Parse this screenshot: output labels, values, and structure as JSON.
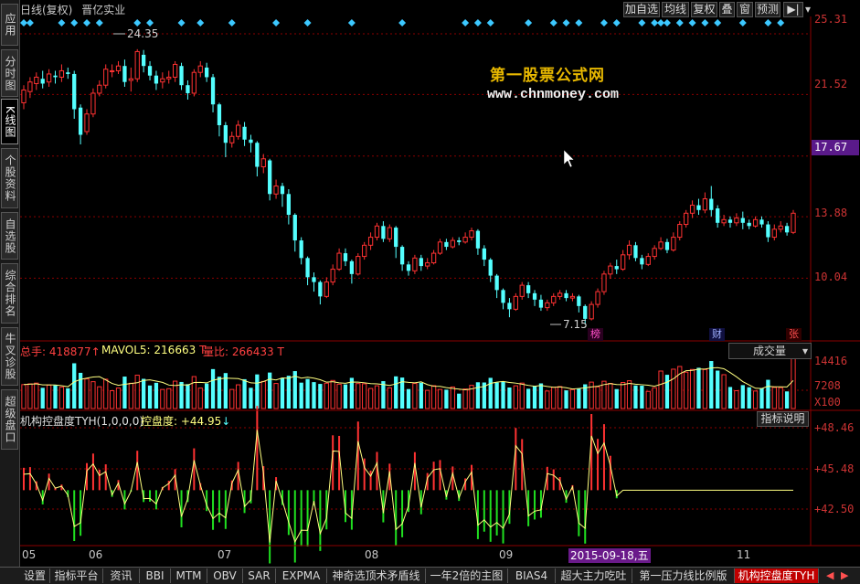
{
  "header": {
    "title": "日线(复权)",
    "stock_name": "晋亿实业",
    "buttons": [
      "加自选",
      "均线",
      "复权",
      "叠",
      "窗",
      "预测"
    ],
    "nav_arrow": "▶|"
  },
  "left_tabs": [
    {
      "label": "应用",
      "active": false
    },
    {
      "label": "分时图",
      "active": false
    },
    {
      "label": "K线图",
      "active": true
    },
    {
      "label": "个股资料",
      "active": false
    },
    {
      "label": "自选股",
      "active": false
    },
    {
      "label": "综合排名",
      "active": false
    },
    {
      "label": "牛叉诊股",
      "active": false
    },
    {
      "label": "超级盘口",
      "active": false
    }
  ],
  "price_axis": {
    "labels": [
      "25.31",
      "21.52",
      "17.67",
      "13.88",
      "10.04"
    ],
    "current_price_box": "17.67"
  },
  "watermark": {
    "cn": "第一股票公式网",
    "url": "www.chnmoney.com"
  },
  "annotations": {
    "high": "24.35",
    "low": "7.15"
  },
  "event_marks": [
    {
      "text": "榜",
      "color": "#ff50c8"
    },
    {
      "text": "财",
      "color": "#a0b0ff"
    },
    {
      "text": "张",
      "color": "#ff5050"
    }
  ],
  "volume_panel": {
    "total_label": "总手: 418877",
    "total_arrow": "↑",
    "mavol5_label": "MAVOL5: 216663",
    "mavol5_unit": "T",
    "ratio_label": "量比: 266433",
    "ratio_unit": "T",
    "dropdown": "成交量",
    "axis_labels": [
      "14416",
      "7208",
      "X100"
    ]
  },
  "indicator_panel": {
    "name": "机构控盘度TYH(1,0,0,0)",
    "value_label": "控盘度: +44.95",
    "value_arrow": "↓",
    "button": "指标说明",
    "axis_labels": [
      "+48.46",
      "+45.48",
      "+42.50"
    ]
  },
  "x_axis": {
    "months": [
      "05",
      "06",
      "07",
      "08",
      "09",
      "11"
    ],
    "selected_date": "2015-09-18,五"
  },
  "bottom_tabs": [
    {
      "label": "设置",
      "active": false
    },
    {
      "label": "指标平台",
      "active": false
    },
    {
      "label": "资讯",
      "active": false
    },
    {
      "label": "BBI",
      "active": false
    },
    {
      "label": "MTM",
      "active": false
    },
    {
      "label": "OBV",
      "active": false
    },
    {
      "label": "SAR",
      "active": false
    },
    {
      "label": "EXPMA",
      "active": false
    },
    {
      "label": "神奇选顶术矛盾线",
      "active": false
    },
    {
      "label": "一年2倍的主图",
      "active": false
    },
    {
      "label": "BIAS4",
      "active": false
    },
    {
      "label": "超大主力吃吐",
      "active": false
    },
    {
      "label": "第一压力线比例版",
      "active": false
    },
    {
      "label": "机构控盘度TYH",
      "active": true
    }
  ],
  "colors": {
    "up": "#ff3232",
    "down": "#54ffff",
    "grid": "#8b0000",
    "ma_line": "#ffff80",
    "watermark": "#e8b800"
  },
  "chart_data": {
    "type": "candlestick",
    "price_range": [
      7.15,
      25.31
    ],
    "candles": [
      [
        21.0,
        21.8,
        20.6,
        22.1
      ],
      [
        21.7,
        22.3,
        21.3,
        22.6
      ],
      [
        22.2,
        22.6,
        21.8,
        22.9
      ],
      [
        22.5,
        22.2,
        21.9,
        23.0
      ],
      [
        22.3,
        22.8,
        22.0,
        23.1
      ],
      [
        22.7,
        22.6,
        22.2,
        23.0
      ],
      [
        22.6,
        23.0,
        22.3,
        23.4
      ],
      [
        22.9,
        22.8,
        22.5,
        23.2
      ],
      [
        22.8,
        20.6,
        20.0,
        23.0
      ],
      [
        20.7,
        19.0,
        18.4,
        20.9
      ],
      [
        19.2,
        20.3,
        19.0,
        20.6
      ],
      [
        20.3,
        21.6,
        20.1,
        21.9
      ],
      [
        21.6,
        22.1,
        21.4,
        22.4
      ],
      [
        22.1,
        23.1,
        21.9,
        23.4
      ],
      [
        23.0,
        23.0,
        22.6,
        23.4
      ],
      [
        23.0,
        23.3,
        22.8,
        23.6
      ],
      [
        23.3,
        22.3,
        22.0,
        23.7
      ],
      [
        22.4,
        22.5,
        21.7,
        23.2
      ],
      [
        22.5,
        24.2,
        22.3,
        24.35
      ],
      [
        24.0,
        23.3,
        22.9,
        24.3
      ],
      [
        23.3,
        22.7,
        22.4,
        23.6
      ],
      [
        22.7,
        22.2,
        21.8,
        23.0
      ],
      [
        22.3,
        22.5,
        21.9,
        22.9
      ],
      [
        22.5,
        22.6,
        22.2,
        23.0
      ],
      [
        22.6,
        23.4,
        22.3,
        23.6
      ],
      [
        23.3,
        22.1,
        21.8,
        23.5
      ],
      [
        22.1,
        21.6,
        21.2,
        22.4
      ],
      [
        21.6,
        22.9,
        21.4,
        23.1
      ],
      [
        22.9,
        23.3,
        22.6,
        23.6
      ],
      [
        23.2,
        22.6,
        22.3,
        23.5
      ],
      [
        22.6,
        20.9,
        20.4,
        22.8
      ],
      [
        20.9,
        19.6,
        18.9,
        21.0
      ],
      [
        19.6,
        18.5,
        17.6,
        19.8
      ],
      [
        18.5,
        18.9,
        18.2,
        19.2
      ],
      [
        18.9,
        19.6,
        18.7,
        19.9
      ],
      [
        19.5,
        18.7,
        18.3,
        19.8
      ],
      [
        18.7,
        18.5,
        17.9,
        19.0
      ],
      [
        18.5,
        17.0,
        16.4,
        18.6
      ],
      [
        17.0,
        17.5,
        16.6,
        17.8
      ],
      [
        17.4,
        15.3,
        14.9,
        17.5
      ],
      [
        15.3,
        15.8,
        15.0,
        16.2
      ],
      [
        15.8,
        15.3,
        14.5,
        16.0
      ],
      [
        15.3,
        14.0,
        13.4,
        15.6
      ],
      [
        14.0,
        12.4,
        11.7,
        14.1
      ],
      [
        12.4,
        11.3,
        10.9,
        12.6
      ],
      [
        11.3,
        10.1,
        9.6,
        11.4
      ],
      [
        10.1,
        9.8,
        9.2,
        10.4
      ],
      [
        9.8,
        8.9,
        8.4,
        9.9
      ],
      [
        8.9,
        9.8,
        8.8,
        10.1
      ],
      [
        9.8,
        10.6,
        9.6,
        10.9
      ],
      [
        10.6,
        11.6,
        10.5,
        11.9
      ],
      [
        11.6,
        11.1,
        10.8,
        11.9
      ],
      [
        11.1,
        10.3,
        9.7,
        11.2
      ],
      [
        10.3,
        11.4,
        10.2,
        11.6
      ],
      [
        11.4,
        12.1,
        11.2,
        12.3
      ],
      [
        12.1,
        12.6,
        11.8,
        12.9
      ],
      [
        12.6,
        13.3,
        12.4,
        13.5
      ],
      [
        13.3,
        12.5,
        12.3,
        13.6
      ],
      [
        12.5,
        13.2,
        12.3,
        13.4
      ],
      [
        13.2,
        12.0,
        11.3,
        13.3
      ],
      [
        12.0,
        10.9,
        10.5,
        12.1
      ],
      [
        10.9,
        10.5,
        10.2,
        11.1
      ],
      [
        10.5,
        11.3,
        10.3,
        11.5
      ],
      [
        11.3,
        10.8,
        10.5,
        11.5
      ],
      [
        10.8,
        11.0,
        10.6,
        11.3
      ],
      [
        11.0,
        11.6,
        10.9,
        11.8
      ],
      [
        11.6,
        12.3,
        11.5,
        12.5
      ],
      [
        12.3,
        12.0,
        11.8,
        12.5
      ],
      [
        12.0,
        12.4,
        11.9,
        12.6
      ],
      [
        12.4,
        12.3,
        12.1,
        12.6
      ],
      [
        12.3,
        12.6,
        12.2,
        12.9
      ],
      [
        12.6,
        13.0,
        12.4,
        13.2
      ],
      [
        13.0,
        11.9,
        11.5,
        13.1
      ],
      [
        11.9,
        11.2,
        10.8,
        12.1
      ],
      [
        11.2,
        10.2,
        9.8,
        11.3
      ],
      [
        10.2,
        9.3,
        8.8,
        10.3
      ],
      [
        9.3,
        8.5,
        8.1,
        9.4
      ],
      [
        8.5,
        8.1,
        7.6,
        8.8
      ],
      [
        8.1,
        8.9,
        8.0,
        9.1
      ],
      [
        8.9,
        9.6,
        8.7,
        9.8
      ],
      [
        9.6,
        9.1,
        8.8,
        9.8
      ],
      [
        9.1,
        8.7,
        8.3,
        9.3
      ],
      [
        8.7,
        8.2,
        8.0,
        9.0
      ],
      [
        8.2,
        8.5,
        8.0,
        8.7
      ],
      [
        8.5,
        8.9,
        8.3,
        9.1
      ],
      [
        8.9,
        9.1,
        8.7,
        9.3
      ],
      [
        9.1,
        8.8,
        8.6,
        9.3
      ],
      [
        8.8,
        8.9,
        8.6,
        9.1
      ],
      [
        8.9,
        8.3,
        7.9,
        9.0
      ],
      [
        8.3,
        7.5,
        7.15,
        8.4
      ],
      [
        7.5,
        8.4,
        7.4,
        8.6
      ],
      [
        8.4,
        9.2,
        8.2,
        9.4
      ],
      [
        9.2,
        10.3,
        9.0,
        10.5
      ],
      [
        10.3,
        10.8,
        10.0,
        11.0
      ],
      [
        10.8,
        10.6,
        10.3,
        11.2
      ],
      [
        10.6,
        11.5,
        10.5,
        11.8
      ],
      [
        11.5,
        12.1,
        11.2,
        12.4
      ],
      [
        12.1,
        11.3,
        11.1,
        12.3
      ],
      [
        11.3,
        10.9,
        10.6,
        11.5
      ],
      [
        10.9,
        11.4,
        10.8,
        11.6
      ],
      [
        11.4,
        11.9,
        11.2,
        12.1
      ],
      [
        11.9,
        12.3,
        11.8,
        12.6
      ],
      [
        12.3,
        11.8,
        11.6,
        12.5
      ],
      [
        11.8,
        12.6,
        11.7,
        12.9
      ],
      [
        12.6,
        13.4,
        12.4,
        13.6
      ],
      [
        13.4,
        14.1,
        13.2,
        14.3
      ],
      [
        14.1,
        14.6,
        13.8,
        14.9
      ],
      [
        14.6,
        14.3,
        14.0,
        15.0
      ],
      [
        14.3,
        15.0,
        14.1,
        15.4
      ],
      [
        15.0,
        14.3,
        13.9,
        15.8
      ],
      [
        14.4,
        13.5,
        13.2,
        14.6
      ],
      [
        13.5,
        13.7,
        13.3,
        14.0
      ],
      [
        13.7,
        13.5,
        13.2,
        13.9
      ],
      [
        13.5,
        13.8,
        13.3,
        14.1
      ],
      [
        13.8,
        13.5,
        13.1,
        14.2
      ],
      [
        13.5,
        13.3,
        13.1,
        13.7
      ],
      [
        13.3,
        13.7,
        13.2,
        13.9
      ],
      [
        13.7,
        13.4,
        13.2,
        13.9
      ],
      [
        13.4,
        12.6,
        12.3,
        13.6
      ],
      [
        12.6,
        13.1,
        12.4,
        13.4
      ],
      [
        13.1,
        13.3,
        12.9,
        13.6
      ],
      [
        13.3,
        12.9,
        12.7,
        13.5
      ],
      [
        12.9,
        14.1,
        12.8,
        14.3
      ]
    ],
    "volume_range": [
      0,
      14416
    ],
    "indicator_range": [
      40.5,
      48.46
    ]
  }
}
